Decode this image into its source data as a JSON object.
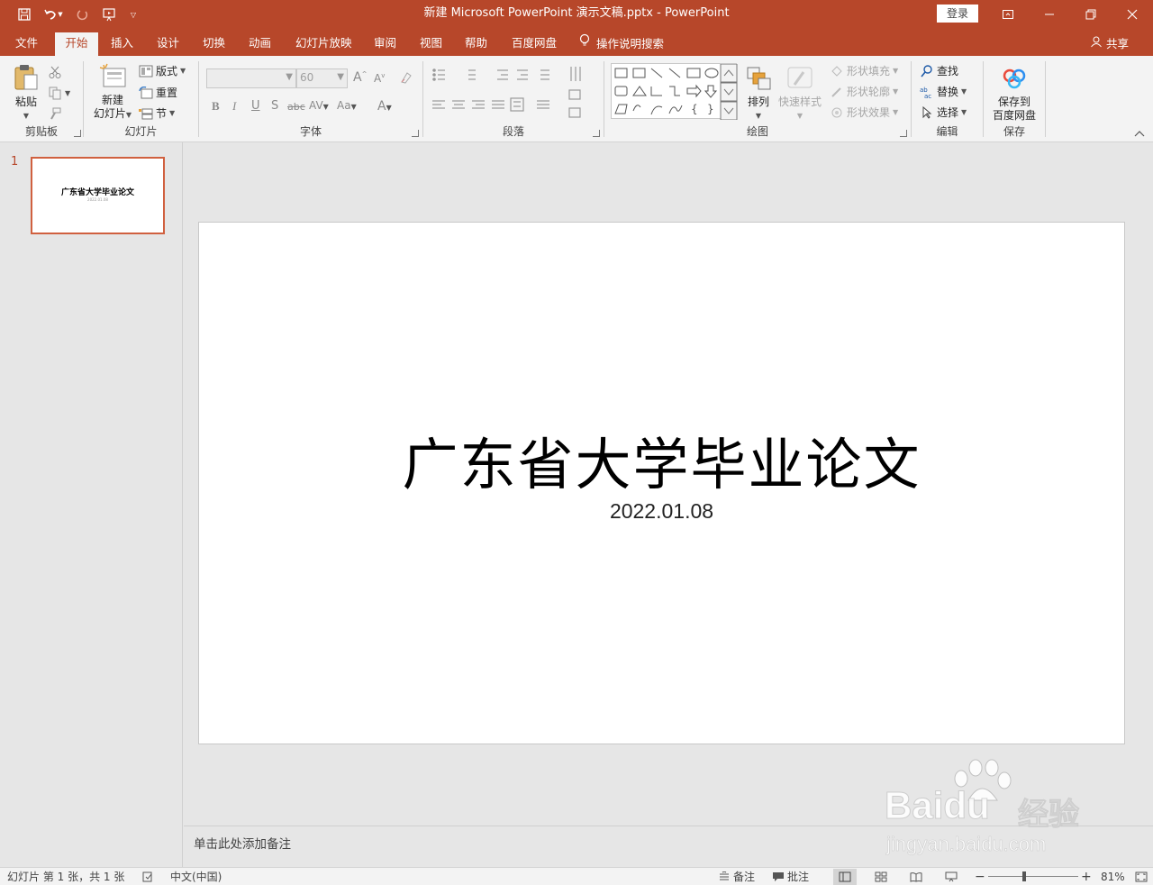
{
  "titlebar": {
    "title": "新建 Microsoft PowerPoint 演示文稿.pptx  -  PowerPoint",
    "login": "登录",
    "accent_color": "#b7472a"
  },
  "tabs": [
    {
      "label": "文件"
    },
    {
      "label": "开始"
    },
    {
      "label": "插入"
    },
    {
      "label": "设计"
    },
    {
      "label": "切换"
    },
    {
      "label": "动画"
    },
    {
      "label": "幻灯片放映"
    },
    {
      "label": "审阅"
    },
    {
      "label": "视图"
    },
    {
      "label": "帮助"
    },
    {
      "label": "百度网盘"
    }
  ],
  "tell_me": "操作说明搜索",
  "share": "共享",
  "ribbon": {
    "clipboard": {
      "label": "剪贴板",
      "paste": "粘贴"
    },
    "slides": {
      "label": "幻灯片",
      "new_slide_line1": "新建",
      "new_slide_line2": "幻灯片",
      "layout": "版式",
      "reset": "重置",
      "section": "节"
    },
    "font": {
      "label": "字体",
      "font_name": "",
      "font_size": "60"
    },
    "paragraph": {
      "label": "段落"
    },
    "drawing": {
      "label": "绘图",
      "arrange": "排列",
      "quick_styles": "快速样式",
      "shape_fill": "形状填充",
      "shape_outline": "形状轮廓",
      "shape_effects": "形状效果"
    },
    "editing": {
      "label": "编辑",
      "find": "查找",
      "replace": "替换",
      "select": "选择"
    },
    "save": {
      "label": "保存",
      "save_line1": "保存到",
      "save_line2": "百度网盘"
    }
  },
  "thumbnails": [
    {
      "number": "1",
      "title": "广东省大学毕业论文",
      "subtitle": "2022.01.08"
    }
  ],
  "slide": {
    "title": "广东省大学毕业论文",
    "subtitle": "2022.01.08"
  },
  "notes_placeholder": "单击此处添加备注",
  "watermark": {
    "brand": "Baidu",
    "product": "经验",
    "url": "jingyan.baidu.com"
  },
  "statusbar": {
    "slide_info": "幻灯片 第 1 张，共 1 张",
    "language": "中文(中国)",
    "notes": "备注",
    "comments": "批注",
    "zoom": "81%"
  }
}
